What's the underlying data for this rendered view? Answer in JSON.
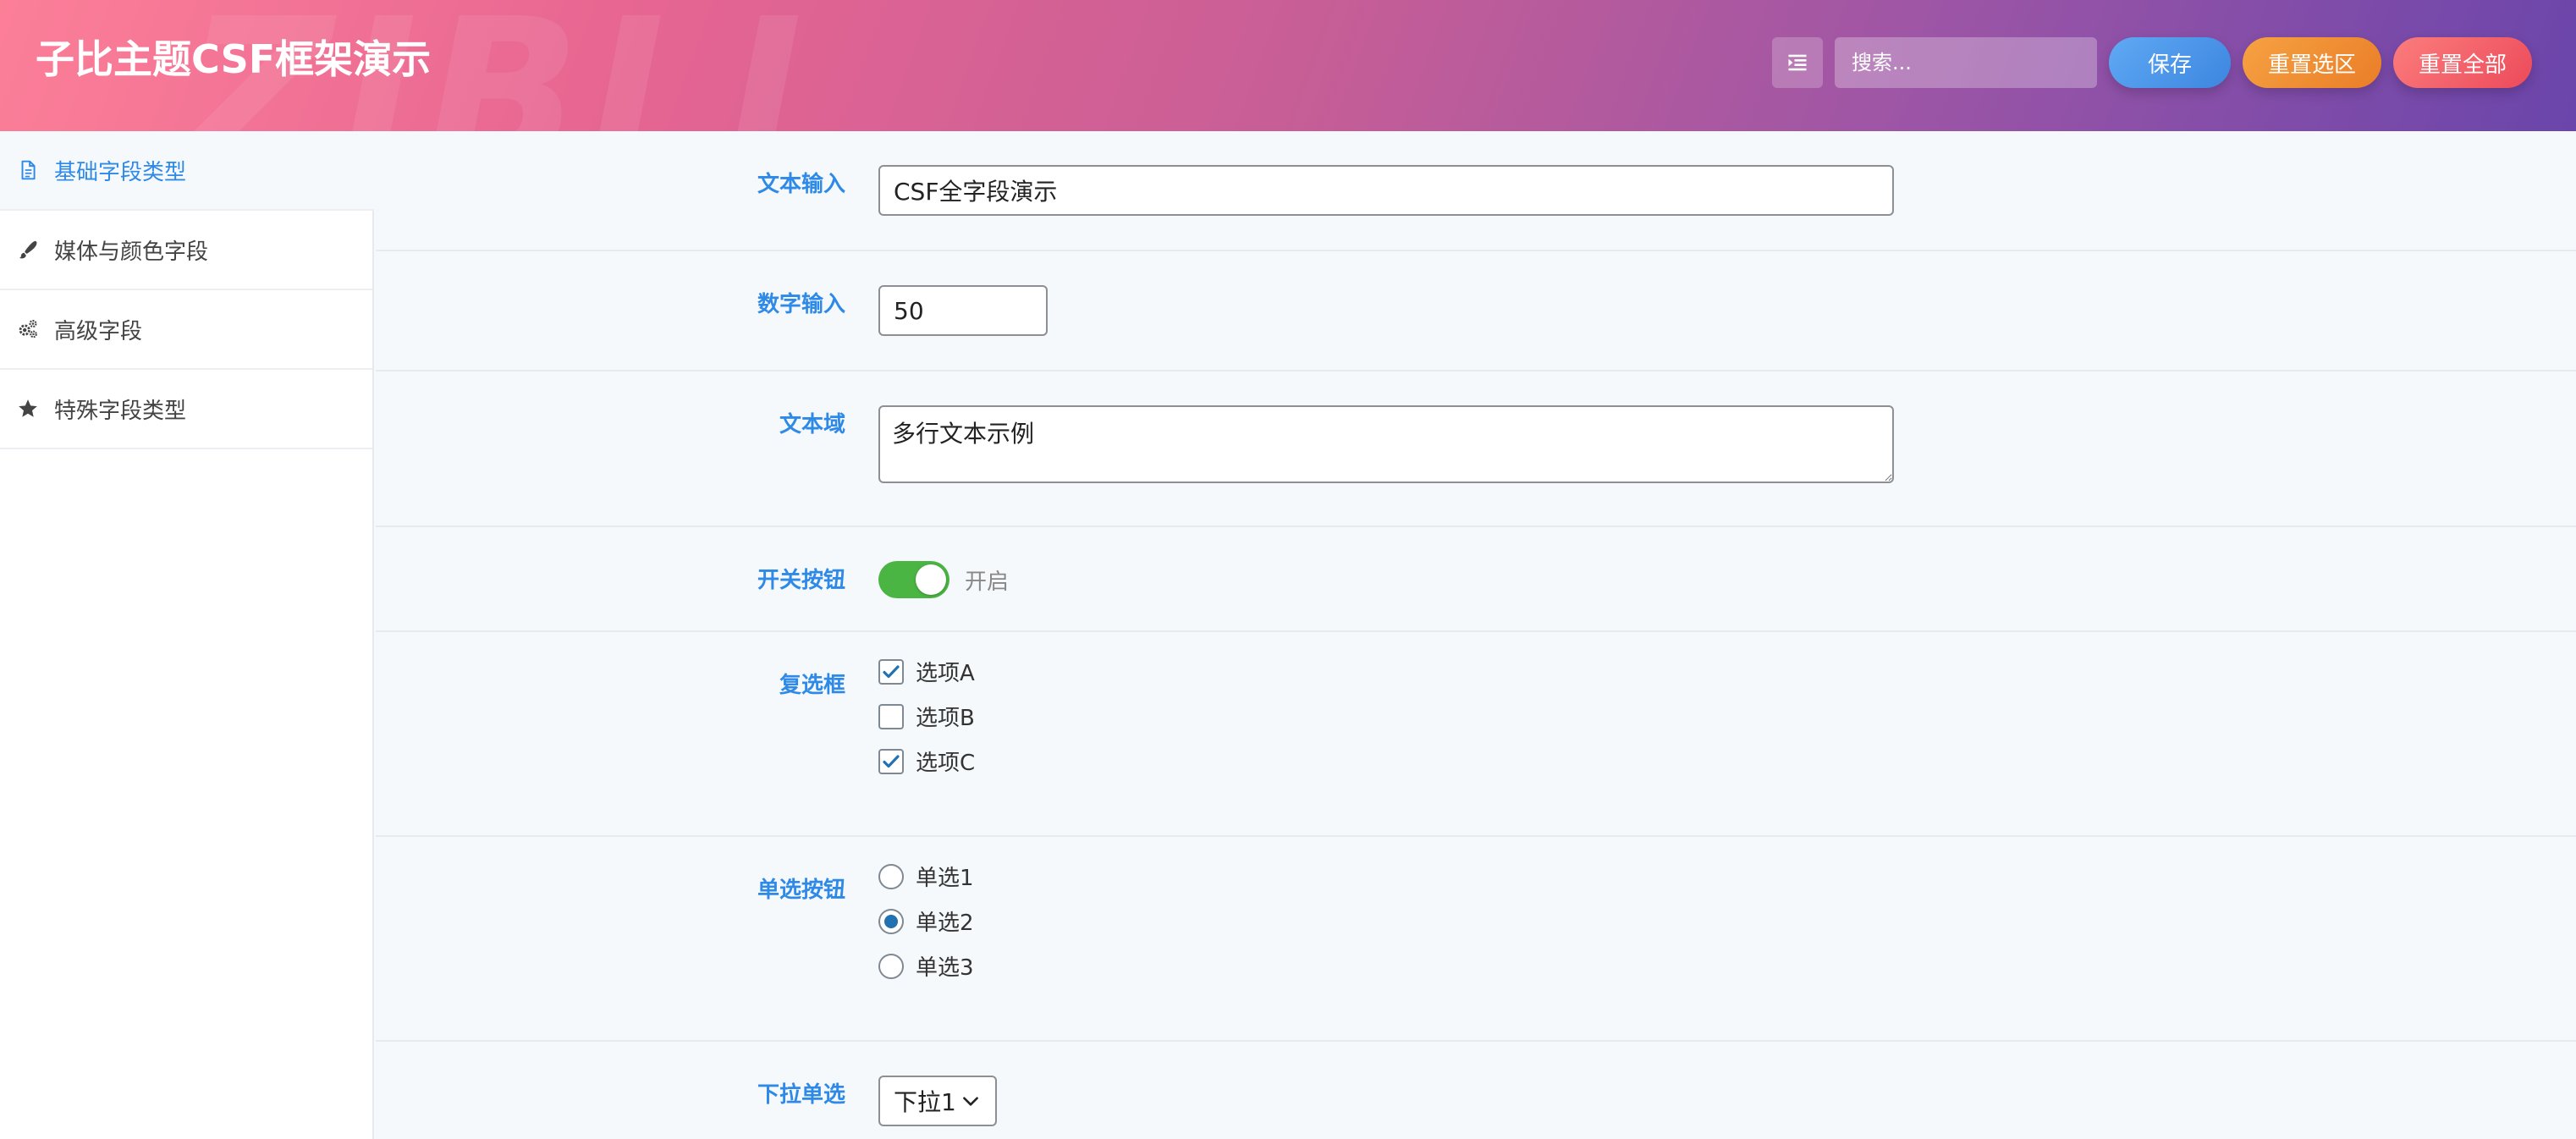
{
  "header": {
    "title": "子比主题CSF框架演示",
    "watermark": "ZIBLL",
    "search_placeholder": "搜索...",
    "save_label": "保存",
    "reset_section_label": "重置选区",
    "reset_all_label": "重置全部"
  },
  "sidebar": {
    "items": [
      {
        "label": "基础字段类型",
        "icon": "document-icon",
        "active": true
      },
      {
        "label": "媒体与颜色字段",
        "icon": "paintbrush-icon",
        "active": false
      },
      {
        "label": "高级字段",
        "icon": "gears-icon",
        "active": false
      },
      {
        "label": "特殊字段类型",
        "icon": "star-icon",
        "active": false
      }
    ]
  },
  "fields": {
    "text": {
      "label": "文本输入",
      "value": "CSF全字段演示"
    },
    "number": {
      "label": "数字输入",
      "value": "50"
    },
    "textarea": {
      "label": "文本域",
      "value": "多行文本示例"
    },
    "switch": {
      "label": "开关按钮",
      "state_text": "开启",
      "on": true
    },
    "checkbox": {
      "label": "复选框",
      "options": [
        {
          "label": "选项A",
          "checked": true
        },
        {
          "label": "选项B",
          "checked": false
        },
        {
          "label": "选项C",
          "checked": true
        }
      ]
    },
    "radio": {
      "label": "单选按钮",
      "options": [
        {
          "label": "单选1",
          "selected": false
        },
        {
          "label": "单选2",
          "selected": true
        },
        {
          "label": "单选3",
          "selected": false
        }
      ]
    },
    "select": {
      "label": "下拉单选",
      "value": "下拉1"
    }
  },
  "colors": {
    "accent": "#2e8ae6",
    "switch_on": "#4bb543",
    "save_button": "#3d86e0",
    "reset_section_button": "#ea7d27",
    "reset_all_button": "#ec4a5a"
  }
}
